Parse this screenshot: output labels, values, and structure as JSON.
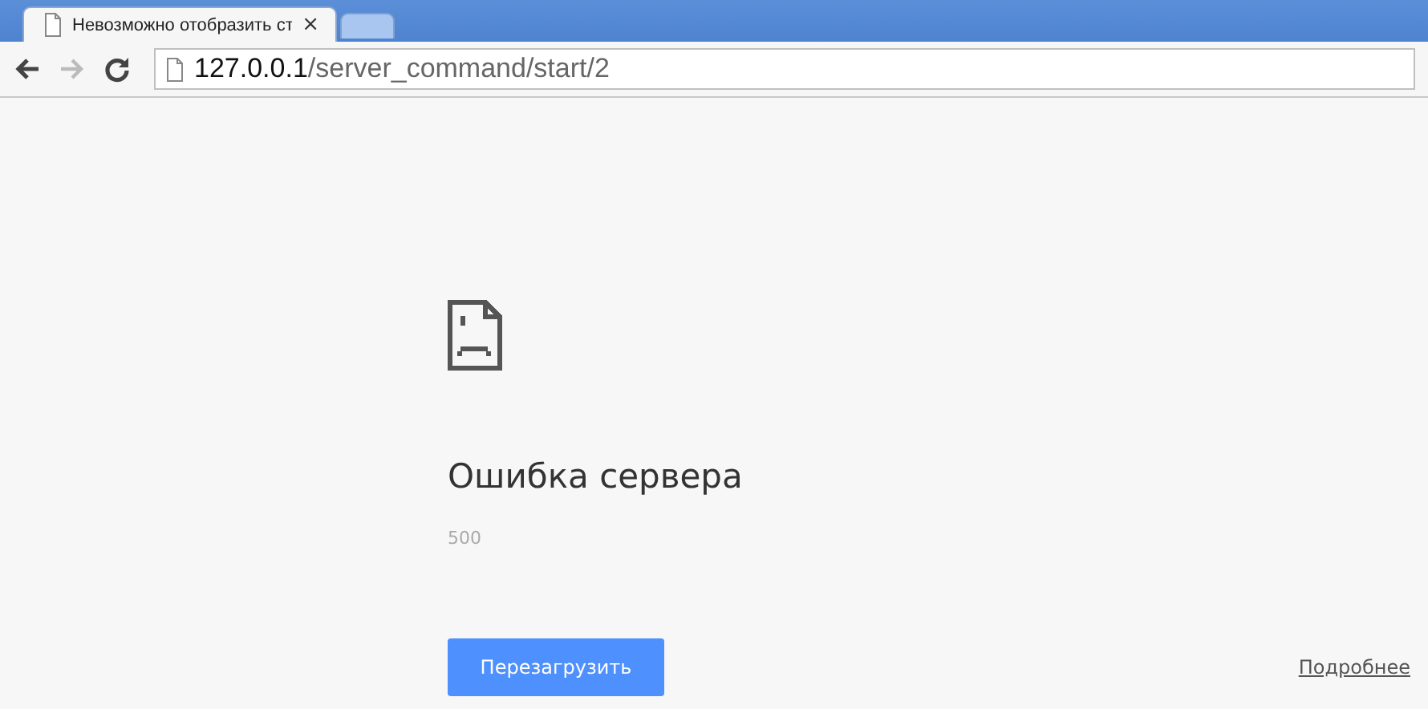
{
  "tabs": [
    {
      "title": "Невозможно отобразить ст",
      "selected": true,
      "close": "×"
    },
    {
      "selected": false
    }
  ],
  "address": {
    "host": "127.0.0.1",
    "path": "/server_command/start/2"
  },
  "error": {
    "title": "Ошибка сервера",
    "code": "500"
  },
  "buttons": {
    "reload": "Перезагрузить",
    "details": "Подробнее"
  }
}
